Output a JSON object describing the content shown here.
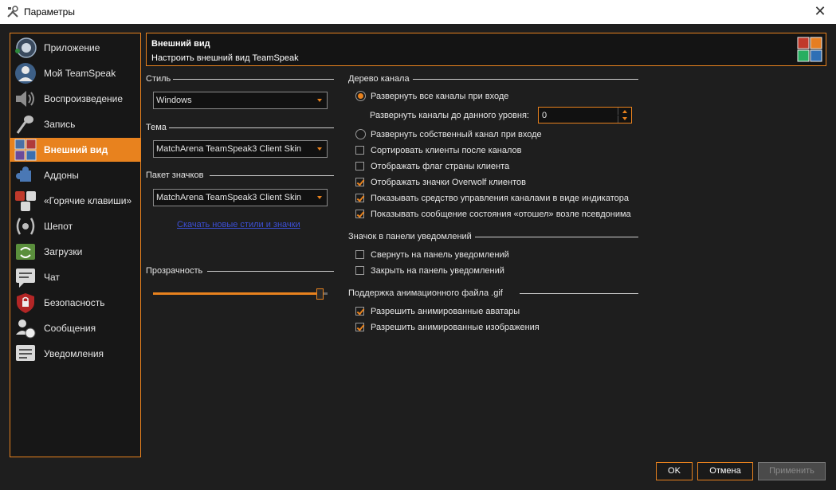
{
  "window": {
    "title": "Параметры"
  },
  "sidebar": {
    "items": [
      {
        "label": "Приложение",
        "icon": "teamspeak-logo-icon"
      },
      {
        "label": "Мой TeamSpeak",
        "icon": "user-profile-icon"
      },
      {
        "label": "Воспроизведение",
        "icon": "speaker-icon"
      },
      {
        "label": "Запись",
        "icon": "microphone-icon"
      },
      {
        "label": "Внешний вид",
        "icon": "appearance-grid-icon",
        "active": true
      },
      {
        "label": "Аддоны",
        "icon": "puzzle-icon"
      },
      {
        "label": "«Горячие клавиши»",
        "icon": "hotkeys-icon"
      },
      {
        "label": "Шепот",
        "icon": "whisper-icon"
      },
      {
        "label": "Загрузки",
        "icon": "downloads-icon"
      },
      {
        "label": "Чат",
        "icon": "chat-icon"
      },
      {
        "label": "Безопасность",
        "icon": "security-lock-icon"
      },
      {
        "label": "Сообщения",
        "icon": "messages-icon"
      },
      {
        "label": "Уведомления",
        "icon": "notifications-icon"
      }
    ]
  },
  "header": {
    "title": "Внешний вид",
    "subtitle": "Настроить внешний вид TeamSpeak",
    "icon": "appearance-grid-icon"
  },
  "left": {
    "style_label": "Стиль",
    "style_value": "Windows",
    "theme_label": "Тема",
    "theme_value": "MatchArena TeamSpeak3 Client Skin",
    "iconpack_label": "Пакет значков",
    "iconpack_value": "MatchArena TeamSpeak3 Client Skin",
    "download_link": "Скачать новые стили и значки",
    "transparency_label": "Прозрачность",
    "transparency_level": 0.97
  },
  "channel_tree": {
    "label": "Дерево канала",
    "radio_expand_all": {
      "label": "Развернуть все каналы при входе",
      "checked": true
    },
    "expand_level_label": "Развернуть каналы до данного уровня:",
    "expand_level_value": "0",
    "radio_expand_own": {
      "label": "Развернуть собственный канал при входе",
      "checked": false
    },
    "checkboxes": [
      {
        "label": "Сортировать клиенты после каналов",
        "checked": false
      },
      {
        "label": "Отображать флаг страны клиента",
        "checked": false
      },
      {
        "label": "Отображать значки Overwolf клиентов",
        "checked": true
      },
      {
        "label": "Показывать средство управления каналами в виде индикатора",
        "checked": true
      },
      {
        "label": "Показывать сообщение состояния «отошел» возле псевдонима",
        "checked": true
      }
    ]
  },
  "tray": {
    "label": "Значок в панели уведомлений",
    "checkboxes": [
      {
        "label": "Свернуть на панель уведомлений",
        "checked": false
      },
      {
        "label": "Закрыть на панель уведомлений",
        "checked": false
      }
    ]
  },
  "gif": {
    "label": "Поддержка анимационного файла .gif",
    "checkboxes": [
      {
        "label": "Разрешить анимированные аватары",
        "checked": true
      },
      {
        "label": "Разрешить анимированные изображения",
        "checked": true
      }
    ]
  },
  "buttons": {
    "ok": "OK",
    "cancel": "Отмена",
    "apply": "Применить"
  },
  "colors": {
    "accent": "#e8821e",
    "background": "#1e1e1e",
    "link": "#3c4fd6"
  }
}
